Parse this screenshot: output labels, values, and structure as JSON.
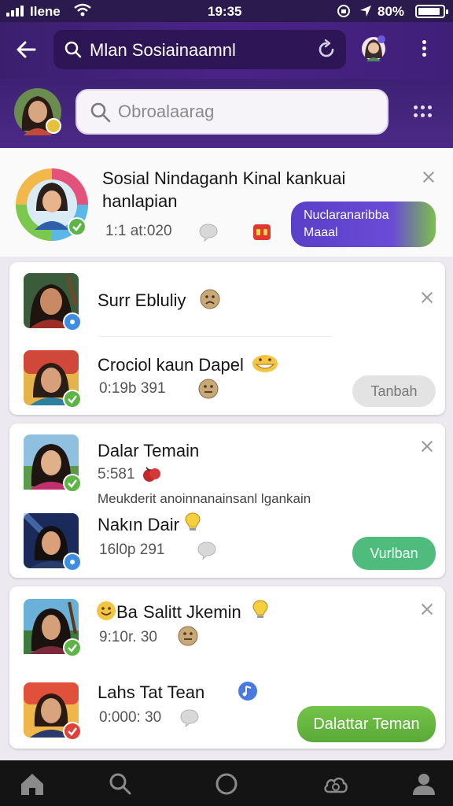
{
  "status_bar": {
    "carrier": "Ilene",
    "time": "19:35",
    "battery": "80%"
  },
  "app_bar": {
    "title": "Mlan Sosiainaamnl"
  },
  "search": {
    "placeholder": "Obroalaarag"
  },
  "featured": {
    "title_line1": "Sosial Nindaganh Kinal kankuai",
    "title_line2": "hanlapian",
    "time": "1:1 at:020",
    "button_line1": "Nuclaranaribba",
    "button_line2": "Maaal"
  },
  "card1": {
    "items": [
      {
        "name": "Surr Ebluliy"
      },
      {
        "name": "Crociol kaun Dapel",
        "time": "0:19b 391",
        "button": "Tanbah"
      }
    ]
  },
  "card2": {
    "items": [
      {
        "name": "Dalar Temain",
        "time": "5:581",
        "note": "Meukderit anoinnanainsanl lgankain"
      },
      {
        "name": "Nakın Dair",
        "time": "16l0p 291",
        "button": "Vurlban"
      }
    ]
  },
  "card3": {
    "items": [
      {
        "name_prefix": "Ba",
        "name": "Salitt Jkemin",
        "time": "9:10r. 30"
      },
      {
        "name": "Lahs Tat Tean",
        "time": "0:000: 30",
        "button": "Dalattar Teman"
      }
    ]
  },
  "colors": {
    "header": "#4a2388",
    "accent_green": "#5cb545",
    "accent_purple": "#5a3fc8"
  },
  "icons": {
    "nav": [
      "home-icon",
      "search-icon",
      "circle-icon",
      "cloud-sync-icon",
      "person-icon"
    ]
  }
}
